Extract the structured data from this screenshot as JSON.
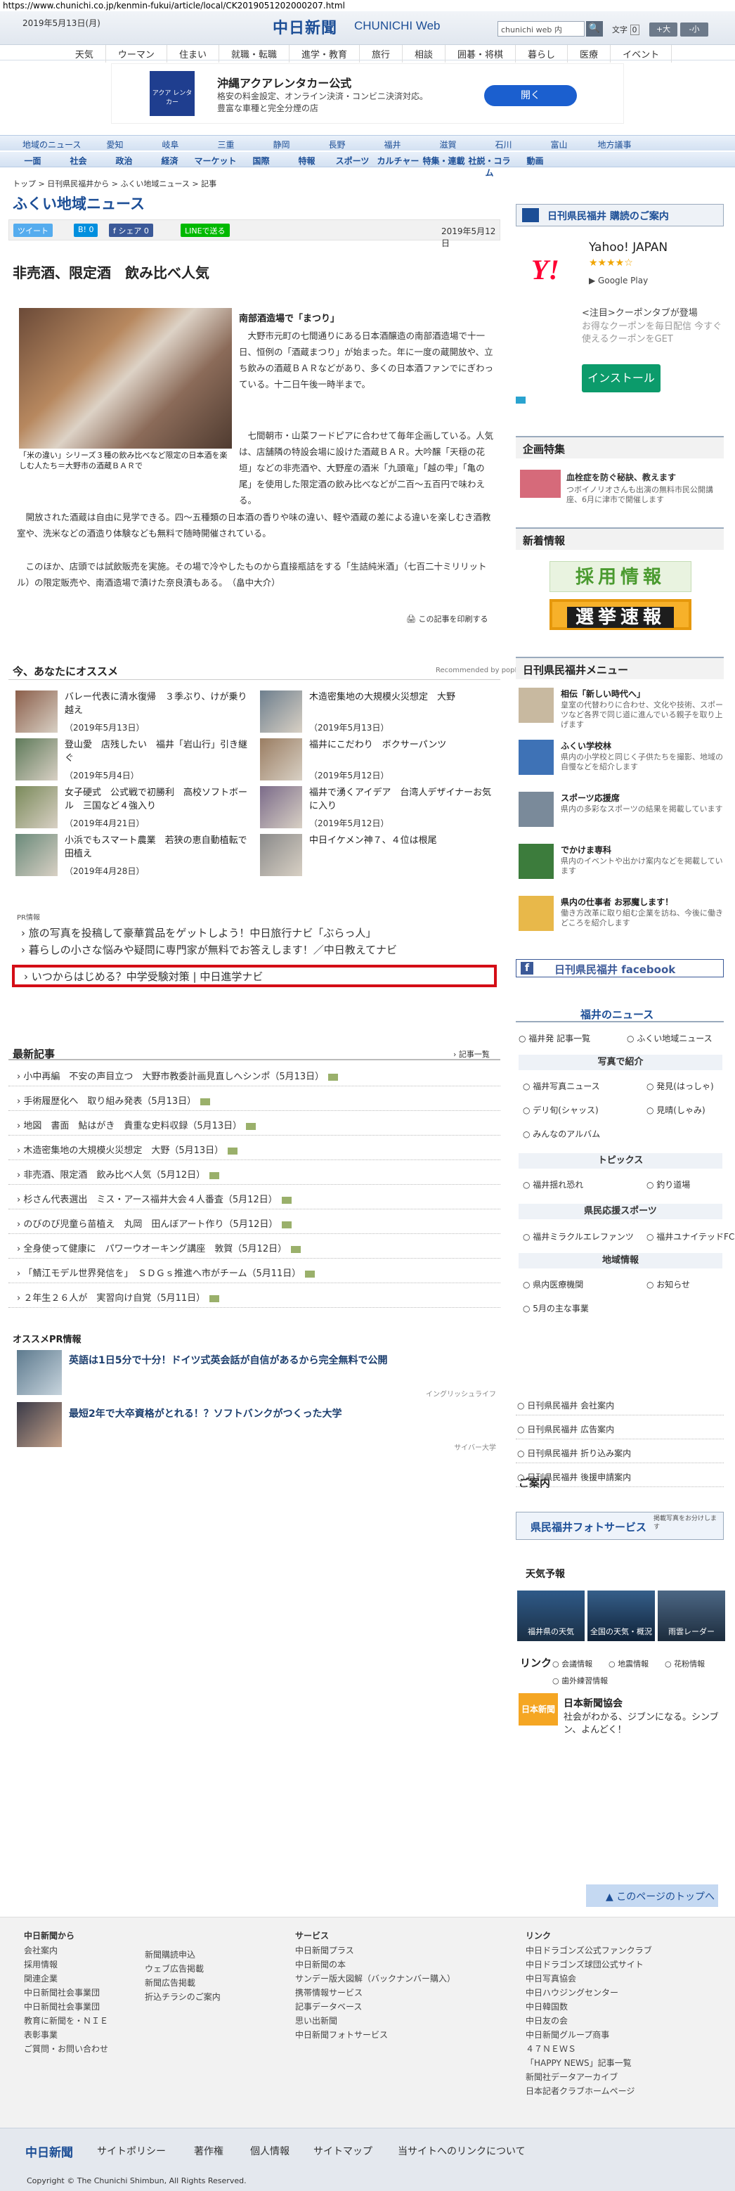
{
  "url": "https://www.chunichi.co.jp/kenmin-fukui/article/local/CK2019051202000207.html",
  "header": {
    "date": "2019年5月13日(月)",
    "logo": "中日新聞",
    "logo_sub": "CHUNICHI Web",
    "search_placeholder": "chunichi web 内",
    "font_label": "文字",
    "font_up": "+大",
    "font_down": "-小"
  },
  "global_nav": [
    "天気",
    "ウーマン",
    "住まい",
    "就職・転職",
    "進学・教育",
    "旅行",
    "相談",
    "囲碁・将棋",
    "暮らし",
    "医療",
    "イベント"
  ],
  "ad": {
    "logo_text": "アクア レンタカー",
    "title": "沖縄アクアレンタカー公式",
    "text": "格安の料金設定、オンライン決済・コンビニ決済対応。豊富な車種と完全分煙の店",
    "button": "開く"
  },
  "cat_nav_1": [
    "地域のニュース",
    "愛知",
    "岐阜",
    "三重",
    "静岡",
    "長野",
    "福井",
    "滋賀",
    "石川",
    "富山",
    "地方議事"
  ],
  "cat_nav_2": [
    "一面",
    "社会",
    "政治",
    "経済",
    "マーケット",
    "国際",
    "特報",
    "スポーツ",
    "カルチャー",
    "特集・連載",
    "社説・コラム",
    "動画"
  ],
  "breadcrumb": "トップ > 日刊県民福井から > ふくい地域ニュース > 記事",
  "page_title": "ふくい地域ニュース",
  "share": {
    "tweet": "ツイート",
    "hatena": "B! 0",
    "facebook": "f シェア 0",
    "line": "LINEで送る",
    "date": "2019年5月12日"
  },
  "article": {
    "title": "非売酒、限定酒　飲み比べ人気",
    "caption": "「米の違い」シリーズ３種の飲み比べなど限定の日本酒を楽しむ人たち＝大野市の酒蔵ＢＡＲで",
    "subhead": "南部酒造場で「まつり」",
    "paragraphs": [
      "大野市元町の七間通りにある日本酒醸造の南部酒造場で十一日、恒例の「酒蔵まつり」が始まった。年に一度の蔵開放や、立ち飲みの酒蔵ＢＡＲなどがあり、多くの日本酒ファンでにぎわっている。十二日午後一時半まで。",
      "七間朝市・山菜フードピアに合わせて毎年企画している。人気は、店舗隣の特設会場に設けた酒蔵ＢＡＲ。大吟醸「天穏の花垣」などの非売酒や、大野産の酒米「九頭竜」「越の雫」「亀の尾」を使用した限定酒の飲み比べなどが二百〜五百円で味わえる。",
      "開放された酒蔵は自由に見学できる。四〜五種類の日本酒の香りや味の違い、軽や酒蔵の差による違いを楽しむき酒教室や、洗米などの酒造り体験なども無料で随時開催されている。",
      "このほか、店頭では試飲販売を実施。その場で冷やしたものから直接瓶詰をする「生詰純米酒」（七百二十ミリリットル）の限定販売や、南酒造場で漬けた奈良漬もある。　（畠中大介）"
    ],
    "print": "この記事を印刷する"
  },
  "recommend": {
    "head": "今、あなたにオススメ",
    "brand": "Recommended by popIn",
    "items": [
      {
        "title": "バレー代表に清水復帰　３季ぶり、けが乗り越え",
        "date": "（2019年5月13日）"
      },
      {
        "title": "木造密集地の大規模火災想定　大野",
        "date": "（2019年5月13日）"
      },
      {
        "title": "登山愛　店残したい　福井「岩山行」引き継ぐ",
        "date": "（2019年5月4日）"
      },
      {
        "title": "福井にこだわり　ボクサーパンツ",
        "date": "（2019年5月12日）"
      },
      {
        "title": "女子硬式　公式戦で初勝利　高校ソフトボール　三国など４強入り",
        "date": "（2019年4月21日）"
      },
      {
        "title": "福井で湧くアイデア　台湾人デザイナーお気に入り",
        "date": "（2019年5月12日）"
      },
      {
        "title": "小浜でもスマート農業　若狭の恵自動植転で田植え",
        "date": "（2019年4月28日）"
      },
      {
        "title": "中日イケメン神７、４位は根尾",
        "date": ""
      }
    ]
  },
  "pr": {
    "label": "PR情報",
    "links": [
      "旅の写真を投稿して豪華賞品をゲットしよう！中日旅行ナビ「ぶらっ人」",
      "暮らしの小さな悩みや疑問に専門家が無料でお答えします！／中日教えてナビ",
      "いつからはじめる？中学受験対策 | 中日進学ナビ"
    ]
  },
  "latest": {
    "head": "最新記事",
    "more": "記事一覧",
    "items": [
      "小中再編　不安の声目立つ　大野市教委計画見直しへシンポ（5月13日）",
      "手術履歴化へ　取り組み発表（5月13日）",
      "地図　書面　鮎はがき　貴重な史料収録（5月13日）",
      "木造密集地の大規模火災想定　大野（5月13日）",
      "非売酒、限定酒　飲み比べ人気（5月12日）",
      "杉さん代表選出　ミス・アース福井大会４人番査（5月12日）",
      "のびのび児童ら苗植え　丸岡　田んぼアート作り（5月12日）",
      "全身使って健康に　パワーウオーキング講座　敦賀（5月12日）",
      "「鯖江モデル世界発信を」　ＳＤＧｓ推進へ市がチーム（5月11日）",
      "２年生２６人が　実習向け自覚（5月11日）"
    ]
  },
  "pr2": {
    "head": "オススメPR情報",
    "items": [
      {
        "title": "英語は1日5分で十分！ドイツ式英会話が自信があるから完全無料で公開",
        "source": "イングリッシュライフ"
      },
      {
        "title": "最短2年で大卒資格がとれる！？ソフトバンクがつくった大学",
        "source": "サイバー大学"
      }
    ]
  },
  "sidebar": {
    "promo": "日刊県民福井 購読のご案内",
    "yahoo": {
      "logo": "Y!",
      "title": "Yahoo! JAPAN",
      "stars": "★★★★☆",
      "store": "Google Play",
      "coupon_head": "<注目>クーポンタブが登場",
      "coupon_text": "お得なクーポンを毎日配信 今すぐ使えるクーポンをGET",
      "install": "インストール"
    },
    "kikaku": {
      "head": "企画特集",
      "title": "血栓症を防ぐ秘訣、教えます",
      "text": "つボイノリオさんも出演の無料市民公開講座、6月に津市で開催します"
    },
    "saiyo": "採用情報",
    "senkyo": "選挙速報",
    "shinchaku_head": "新着情報",
    "menu_head": "日刊県民福井メニュー",
    "menu": [
      {
        "title": "相伝「新しい時代へ」",
        "text": "皇室の代替わりに合わせ、文化や技術、スポーツなど各界で同じ道に進んでいる親子を取り上げます"
      },
      {
        "title": "ふくい学校林",
        "text": "県内の小学校と同じく子供たちを撮影、地域の自慢などを紹介します"
      },
      {
        "title": "スポーツ応援席",
        "text": "県内の多彩なスポーツの結果を掲載しています"
      },
      {
        "title": "でかけま専科",
        "text": "県内のイベントや出かけ案内などを掲載しています"
      },
      {
        "title": "県内の仕事者 お邪魔します！",
        "text": "働き方改革に取り組む企業を訪ね、今後に働きどころを紹介します"
      }
    ],
    "facebook": "日刊県民福井 facebook",
    "fukui_news": {
      "head": "福井のニュース",
      "links": [
        "福井発 記事一覧",
        "ふくい地域ニュース"
      ],
      "photo_head": "写真で紹介",
      "photo_links": [
        "福井写真ニュース",
        "発見(はっしゃ)",
        "デリ旬(シャッス)",
        "見晴(しゃみ)",
        "みんなのアルバム"
      ],
      "topics_head": "トピックス",
      "topics_links": [
        "福井揺れ恐れ",
        "釣り道場"
      ],
      "sports_head": "県民応援スポーツ",
      "sports_links": [
        "福井ミラクルエレファンツ",
        "福井ユナイテッドFC"
      ],
      "region_head": "地域情報",
      "region_links": [
        "県内医療機関",
        "お知らせ",
        "5月の主な事業"
      ]
    },
    "guide": {
      "head": "ご案内",
      "links": [
        "日刊県民福井 会社案内",
        "日刊県民福井 広告案内",
        "日刊県民福井 折り込み案内",
        "日刊県民福井 後援申請案内"
      ]
    },
    "photo_service": "県民福井フォトサービス",
    "photo_service_note": "掲載写真をお分けします",
    "weather": {
      "head": "天気予報",
      "tiles": [
        "福井県の天気",
        "全国の天気・概況",
        "雨雲レーダー"
      ]
    },
    "link": {
      "head": "リンク",
      "links": [
        "会議情報",
        "地震情報",
        "花粉情報",
        "歯外練習情報"
      ]
    },
    "jna": {
      "logo": "日本新聞協会",
      "title": "日本新聞協会",
      "text": "社会がわかる、ジブンになる。シンブン、よんどく！"
    }
  },
  "to_top": "このページのトップへ",
  "footer": {
    "cols": [
      {
        "head": "中日新聞から",
        "links": [
          "会社案内",
          "採用情報",
          "関連企業",
          "中日新聞社会事業団",
          "中日新聞社会事業団",
          "教育に新聞を・ＮＩＥ",
          "表彰事業",
          "ご質問・お問い合わせ"
        ]
      },
      {
        "head": "",
        "links": [
          "新聞購読申込",
          "ウェブ広告掲載",
          "新聞広告掲載",
          "折込チラシのご案内"
        ]
      },
      {
        "head": "サービス",
        "links": [
          "中日新聞プラス",
          "中日新聞の本",
          "サンデー版大図解（バックナンバー購入）",
          "携帯情報サービス",
          "記事データベース",
          "思い出新聞",
          "中日新聞フォトサービス"
        ]
      },
      {
        "head": "リンク",
        "links": [
          "中日ドラゴンズ公式ファンクラブ",
          "中日ドラゴンズ球団公式サイト",
          "中日写真協会",
          "中日ハウジングセンター",
          "中日韓国数",
          "中日友の会",
          "中日新聞グループ商事",
          "４７ＮＥＷＳ",
          "「HAPPY NEWS」記事一覧",
          "新聞社データアーカイブ",
          "日本記者クラブホームページ"
        ]
      }
    ],
    "bottom_logo": "中日新聞",
    "bottom_links": [
      "サイトポリシー",
      "著作権",
      "個人情報",
      "サイトマップ",
      "当サイトへのリンクについて"
    ],
    "copyright": "Copyright © The Chunichi Shimbun, All Rights Reserved."
  }
}
